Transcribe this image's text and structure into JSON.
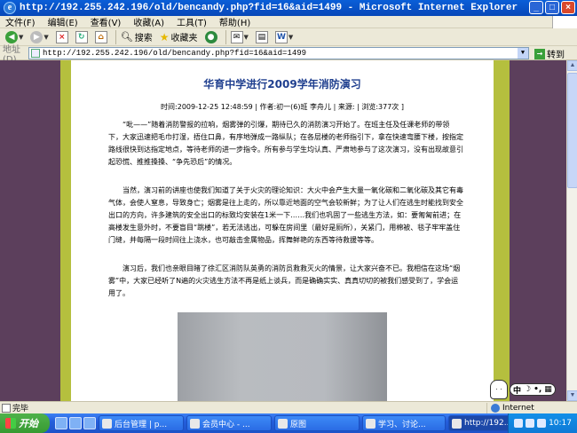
{
  "window": {
    "title": "http://192.255.242.196/old/bencandy.php?fid=16&aid=1499 - Microsoft Internet Explorer",
    "min": "_",
    "max": "□",
    "close": "×"
  },
  "menu": [
    "文件(F)",
    "编辑(E)",
    "查看(V)",
    "收藏(A)",
    "工具(T)",
    "帮助(H)"
  ],
  "toolbar": {
    "search_label": "搜索",
    "favorites_label": "收藏夹"
  },
  "address": {
    "label": "地址(D)",
    "url": "http://192.255.242.196/old/bencandy.php?fid=16&aid=1499",
    "go_label": "转到"
  },
  "article": {
    "title": "华育中学进行2009学年消防演习",
    "meta": "时间:2009-12-25 12:48:59 | 作者:初一(6)班 李舟儿 | 来源: | 浏览:377次 ]",
    "paragraphs": [
      "“吡——”随着消防警报的拉响，烟雾弹的引爆，期待已久的消防演习开始了。在班主任及任课老师的带领下，大家迅速把毛巾打湿，捂住口鼻，有序地弹成一路纵队；在各层楼的老师指引下，拿在快速弯腰下楼，按指定路线很快到达指定地点，等待老师的进一步指令。所有参与学生均认真、严肃地参与了这次演习，没有出现故意引起恐慌、推推搡搡、“争先恐后”的情况。",
      "当然，演习前的讲座也使我们知道了关于火灾的理论知识：大火中会产生大量一氧化碳和二氧化碳及其它有毒气体，会使人窒息，导致身亡；烟雾是往上走的，所以靠近地面的空气会较新鲜；为了让人们在逃生时能找到安全出口的方向，许多建筑的安全出口的标致均安装在1米一下……我们也巩固了一些逃生方法，如：要匍匐前进；在高楼发生意外时，不要盲目“跳楼”，若无法逃出，可躲在房间里（最好是厕所），关紧门，用棉被、毯子牢牢盖住门缝，并每隔一段时间往上浇水，也可敲击金属物品，挥舞鲜艳的东西等待救援等等。",
      "演习后，我们也亲眼目睹了徐汇区消防队英勇的消防员救救灭火的情景，让大家兴奋不已。我相信在这场“烟雾”中，大家已经听了N遍的火灾逃生方法不再是纸上谈兵，而是确确实实、真真切切的被我们感受到了，学会运用了。"
    ]
  },
  "ime": {
    "lang": "中"
  },
  "status": {
    "text": "完毕",
    "zone": "Internet"
  },
  "taskbar": {
    "start": "开始",
    "tasks": [
      "后台管理 | p...",
      "会员中心 - ...",
      "原图",
      "学习、讨论...",
      "http://192...."
    ],
    "clock": "10:17"
  }
}
